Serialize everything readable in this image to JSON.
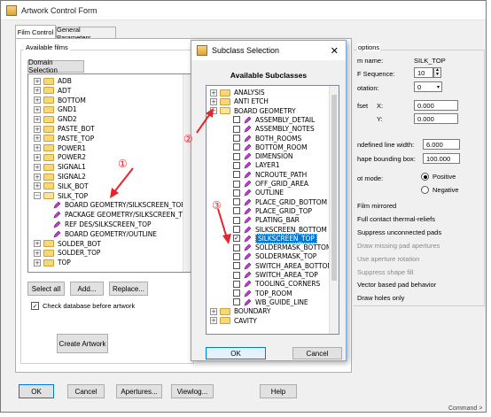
{
  "main": {
    "title": "Artwork Control Form",
    "tabs": [
      "Film Control",
      "General Parameters"
    ],
    "available_films_label": "Available films",
    "domain_button": "Domain Selection",
    "films": [
      {
        "pm": "+",
        "name": "ADB"
      },
      {
        "pm": "+",
        "name": "ADT"
      },
      {
        "pm": "+",
        "name": "BOTTOM"
      },
      {
        "pm": "+",
        "name": "GND1"
      },
      {
        "pm": "+",
        "name": "GND2"
      },
      {
        "pm": "+",
        "name": "PASTE_BOT"
      },
      {
        "pm": "+",
        "name": "PASTE_TOP"
      },
      {
        "pm": "+",
        "name": "POWER1"
      },
      {
        "pm": "+",
        "name": "POWER2"
      },
      {
        "pm": "+",
        "name": "SIGNAL1"
      },
      {
        "pm": "+",
        "name": "SIGNAL2"
      },
      {
        "pm": "+",
        "name": "SILK_BOT"
      },
      {
        "pm": "−",
        "name": "SILK_TOP",
        "open": true
      }
    ],
    "silk_top_children": [
      "BOARD GEOMETRY/SILKSCREEN_TOP",
      "PACKAGE GEOMETRY/SILKSCREEN_TOP",
      "REF DES/SILKSCREEN_TOP",
      "BOARD GEOMETRY/OUTLINE"
    ],
    "films_after": [
      {
        "pm": "+",
        "name": "SOLDER_BOT"
      },
      {
        "pm": "+",
        "name": "SOLDER_TOP"
      },
      {
        "pm": "+",
        "name": "TOP"
      }
    ],
    "select_all": "Select all",
    "add": "Add...",
    "replace": "Replace...",
    "check_db": "Check database before artwork",
    "create_artwork": "Create Artwork",
    "bottom_buttons": [
      "OK",
      "Cancel",
      "Apertures...",
      "Viewlog...",
      "Help"
    ],
    "options": {
      "group_label": "options",
      "film_name_label": "m name:",
      "film_name": "SILK_TOP",
      "sequence_label": "F Sequence:",
      "sequence": "10",
      "rotation_label": "otation:",
      "rotation": "0",
      "offset_label": "fset",
      "x_label": "X:",
      "x": "0.000",
      "y_label": "Y:",
      "y": "0.000",
      "undefined_label": "ndefined line width:",
      "undefined": "6.000",
      "shape_label": "hape bounding box:",
      "shape": "100.000",
      "plot_mode_label": "ot mode:",
      "positive": "Positive",
      "negative": "Negative",
      "checks": [
        "Film mirrored",
        "Full contact thermal-reliefs",
        "Suppress unconnected pads",
        "Draw missing pad apertures",
        "Use aperture rotation",
        "Suppress shape fill",
        "Vector based pad behavior",
        "Draw holes only"
      ]
    },
    "command_text": "Command >"
  },
  "dialog": {
    "title": "Subclass Selection",
    "heading": "Available Subclasses",
    "top": [
      {
        "pm": "+",
        "name": "ANALYSIS"
      },
      {
        "pm": "+",
        "name": "ANTI ETCH"
      },
      {
        "pm": "−",
        "name": "BOARD GEOMETRY",
        "open": true
      }
    ],
    "items": [
      "ASSEMBLY_DETAIL",
      "ASSEMBLY_NOTES",
      "BOTH_ROOMS",
      "BOTTOM_ROOM",
      "DIMENSION",
      "LAYER1",
      "NCROUTE_PATH",
      "OFF_GRID_AREA",
      "OUTLINE",
      "PLACE_GRID_BOTTOM",
      "PLACE_GRID_TOP",
      "PLATING_BAR",
      "SILKSCREEN_BOTTOM",
      "SILKSCREEN_TOP",
      "SOLDERMASK_BOTTOM",
      "SOLDERMASK_TOP",
      "SWITCH_AREA_BOTTOM",
      "SWITCH_AREA_TOP",
      "TOOLING_CORNERS",
      "TOP_ROOM",
      "WB_GUIDE_LINE"
    ],
    "checked_item": "SILKSCREEN_TOP",
    "bottom": [
      {
        "pm": "+",
        "name": "BOUNDARY"
      },
      {
        "pm": "+",
        "name": "CAVITY"
      }
    ],
    "ok": "OK",
    "cancel": "Cancel"
  },
  "annotations": [
    "①",
    "②",
    "③"
  ]
}
